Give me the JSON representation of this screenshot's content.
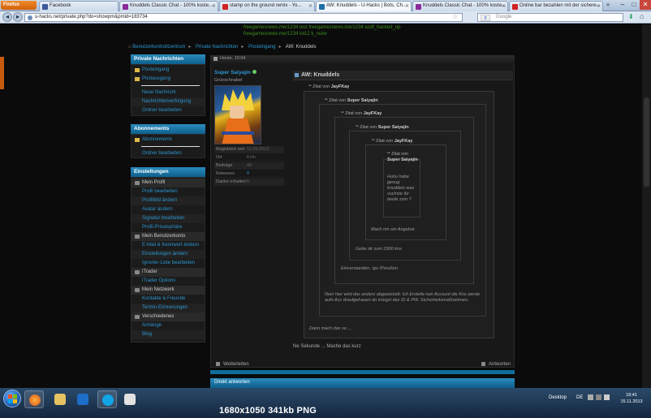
{
  "browser": {
    "firefox_button": "Firefox",
    "tabs": [
      {
        "label": "Facebook",
        "color": "#3b5998"
      },
      {
        "label": "Knuddels Classic Chat - 100% koste...",
        "color": "#8a2a9a"
      },
      {
        "label": "stamp on the ground remix - Yo...",
        "color": "#d22222"
      },
      {
        "label": "AW: Knuddels - U-Hacks | Bots, Ch...",
        "color": "#1f6fa8"
      },
      {
        "label": "Knuddels Classic Chat - 100% koste...",
        "color": "#8a2a9a"
      },
      {
        "label": "Online bar bezahlen mit der sichere...",
        "color": "#d22222"
      }
    ],
    "url": "u-hacks.net/private.php?do=showpm&pmid=183734",
    "search_placeholder": "Google",
    "window_controls": [
      "–",
      "□",
      "✕"
    ]
  },
  "shoutbox": [
    "freegamesnews.me/1234  test  freegamesnews.me/1234  asdf_hacked_up",
    "freegamesnews.me/1234  lol12  k_nuke"
  ],
  "breadcrumb": [
    "Benutzerkontrollzentrum",
    "Private Nachrichten",
    "Posteingang",
    "AW: Knuddels"
  ],
  "sidebar": {
    "private_header": "Private Nachrichten",
    "folders": [
      "Posteingang",
      "Postausgang"
    ],
    "private_links": [
      "Neue Nachricht",
      "Nachrichtenverfolgung",
      "Ordner bearbeiten"
    ],
    "abo_header": "Abonnements",
    "abo_folder": "Abonnements",
    "abo_links": [
      "Ordner bearbeiten"
    ],
    "settings_header": "Einstellungen",
    "settings_items": [
      {
        "label": "Mein Profil",
        "type": "group"
      },
      {
        "label": "Profil bearbeiten",
        "type": "link"
      },
      {
        "label": "Profilbild ändern",
        "type": "link"
      },
      {
        "label": "Avatar ändern",
        "type": "link"
      },
      {
        "label": "Signatur bearbeiten",
        "type": "link"
      },
      {
        "label": "Profil-Privatsphäre",
        "type": "link"
      },
      {
        "label": "Mein Benutzerkonto",
        "type": "group"
      },
      {
        "label": "E-Mail & Kennwort ändern",
        "type": "link"
      },
      {
        "label": "Einstellungen ändern",
        "type": "link"
      },
      {
        "label": "Ignorier-Liste bearbeiten",
        "type": "link"
      },
      {
        "label": "iTrader",
        "type": "group"
      },
      {
        "label": "iTrader Options",
        "type": "link"
      },
      {
        "label": "Mein Netzwerk",
        "type": "group"
      },
      {
        "label": "Kontakte & Freunde",
        "type": "link"
      },
      {
        "label": "Termin-Erinnerungen",
        "type": "link"
      },
      {
        "label": "Verschiedenes",
        "type": "group"
      },
      {
        "label": "Anhänge",
        "type": "link"
      },
      {
        "label": "Blog",
        "type": "link"
      }
    ]
  },
  "post": {
    "date": "Heute, 10:04",
    "username": "Super Saiyajin",
    "user_title": "Grünschnabel",
    "stats": [
      {
        "label": "Registriert seit",
        "value": "12.09.2013"
      },
      {
        "label": "Ort",
        "value": "Köln"
      },
      {
        "label": "Beiträge",
        "value": "43"
      },
      {
        "label": "Releases",
        "value": "0"
      },
      {
        "label": "Danke erhalten",
        "value": "5"
      }
    ],
    "title": "AW: Knuddels",
    "quote_prefix": "Zitat von",
    "quotes": [
      {
        "author": "JayFKay",
        "text": "Dann mach das so ..."
      },
      {
        "author": "Super Saiyajin",
        "text": "Nein hier wird das anders abgewickelt. Ich Erstelle nen Account die Kns werde aufn Acc draufgehauen du kriegst das ID & PW. Sicherheitsmaßnahmen."
      },
      {
        "author": "JayFKay",
        "text": "Einverstanden. /go /Preußen"
      },
      {
        "author": "Super Saiyajin",
        "text": "Gebe dir zum 2300 kns"
      },
      {
        "author": "JayFKay",
        "text": "Mach mir ein Angebot."
      },
      {
        "author": "Super Saiyajin",
        "text": "Huhu habe genug knuddels was suchste für beide zsm ?"
      }
    ],
    "reply_text": "Ne Sekunde ... Mache das kurz",
    "forward_label": "Weiterleiten",
    "answer_label": "Antworten",
    "quick_reply_label": "Direkt antworten"
  },
  "taskbar": {
    "desktop_label": "Desktop",
    "lang": "DE",
    "time": "18:41",
    "date": "15.11.2013"
  },
  "caption": "1680x1050  341kb  PNG"
}
